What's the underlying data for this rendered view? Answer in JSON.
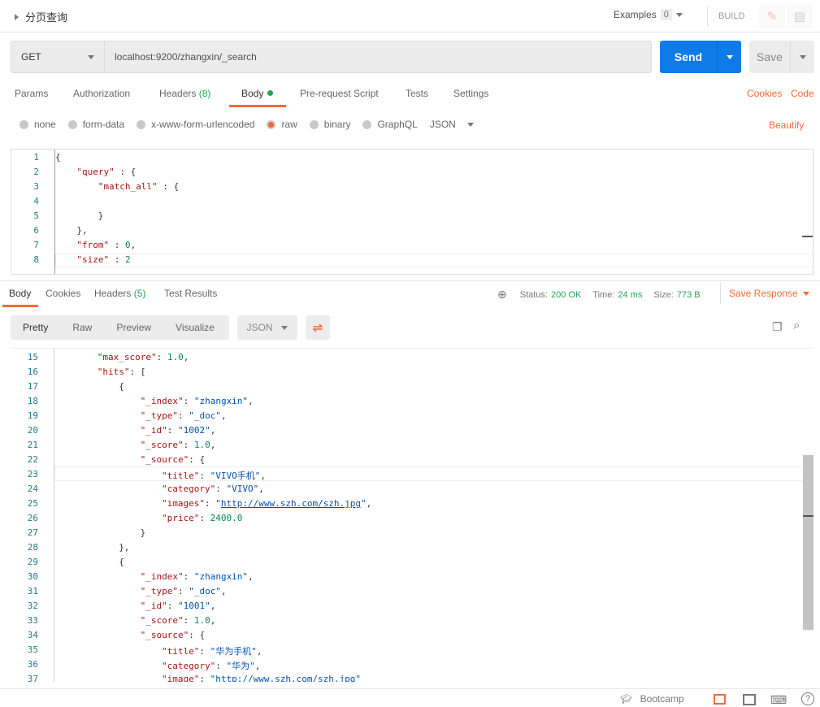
{
  "header": {
    "title": "分页查询",
    "examples_label": "Examples",
    "examples_count": "0",
    "build_label": "BUILD",
    "icons": [
      "pencil-icon",
      "comment-icon"
    ]
  },
  "request": {
    "method": "GET",
    "url": "localhost:9200/zhangxin/_search",
    "send_label": "Send",
    "save_label": "Save"
  },
  "request_tabs": [
    {
      "label": "Params"
    },
    {
      "label": "Authorization"
    },
    {
      "label": "Headers",
      "count": "(8)"
    },
    {
      "label": "Body",
      "active": true
    },
    {
      "label": "Pre-request Script"
    },
    {
      "label": "Tests"
    },
    {
      "label": "Settings"
    }
  ],
  "request_links": {
    "cookies": "Cookies",
    "code": "Code"
  },
  "body_types": [
    {
      "label": "none"
    },
    {
      "label": "form-data"
    },
    {
      "label": "x-www-form-urlencoded"
    },
    {
      "label": "raw",
      "selected": true
    },
    {
      "label": "binary"
    },
    {
      "label": "GraphQL"
    }
  ],
  "body_format": "JSON",
  "beautify_label": "Beautify",
  "request_body": [
    {
      "n": "1",
      "i": 0,
      "t": [
        [
          "p",
          "{"
        ]
      ]
    },
    {
      "n": "2",
      "i": 1,
      "t": [
        [
          "k",
          "\"query\""
        ],
        [
          "p",
          " : {"
        ]
      ]
    },
    {
      "n": "3",
      "i": 2,
      "t": [
        [
          "k",
          "\"match_all\""
        ],
        [
          "p",
          " : {"
        ]
      ]
    },
    {
      "n": "4",
      "i": 0,
      "t": []
    },
    {
      "n": "5",
      "i": 2,
      "t": [
        [
          "p",
          "}"
        ]
      ]
    },
    {
      "n": "6",
      "i": 1,
      "t": [
        [
          "p",
          "},"
        ]
      ]
    },
    {
      "n": "7",
      "i": 1,
      "t": [
        [
          "k",
          "\"from\""
        ],
        [
          "p",
          " : "
        ],
        [
          "n",
          "0"
        ],
        [
          "p",
          ","
        ]
      ]
    },
    {
      "n": "8",
      "i": 1,
      "t": [
        [
          "k",
          "\"size\""
        ],
        [
          "p",
          " : "
        ],
        [
          "n",
          "2"
        ]
      ]
    }
  ],
  "response_tabs": [
    {
      "label": "Body",
      "active": true
    },
    {
      "label": "Cookies"
    },
    {
      "label": "Headers",
      "count": "(5)"
    },
    {
      "label": "Test Results"
    }
  ],
  "response_meta": {
    "status_label": "Status:",
    "status": "200 OK",
    "time_label": "Time:",
    "time": "24 ms",
    "size_label": "Size:",
    "size": "773 B",
    "save_response": "Save Response"
  },
  "view_modes": [
    {
      "label": "Pretty",
      "active": true
    },
    {
      "label": "Raw"
    },
    {
      "label": "Preview"
    },
    {
      "label": "Visualize"
    }
  ],
  "response_format": "JSON",
  "response_body": [
    {
      "n": "15",
      "i": 2,
      "t": [
        [
          "k",
          "\"max_score\""
        ],
        [
          "p",
          ": "
        ],
        [
          "n",
          "1.0"
        ],
        [
          "p",
          ","
        ]
      ]
    },
    {
      "n": "16",
      "i": 2,
      "t": [
        [
          "k",
          "\"hits\""
        ],
        [
          "p",
          ": ["
        ]
      ]
    },
    {
      "n": "17",
      "i": 3,
      "t": [
        [
          "p",
          "{"
        ]
      ]
    },
    {
      "n": "18",
      "i": 4,
      "t": [
        [
          "k",
          "\"_index\""
        ],
        [
          "p",
          ": "
        ],
        [
          "s",
          "\"zhangxin\""
        ],
        [
          "p",
          ","
        ]
      ]
    },
    {
      "n": "19",
      "i": 4,
      "t": [
        [
          "k",
          "\"_type\""
        ],
        [
          "p",
          ": "
        ],
        [
          "s",
          "\"_doc\""
        ],
        [
          "p",
          ","
        ]
      ]
    },
    {
      "n": "20",
      "i": 4,
      "t": [
        [
          "k",
          "\"_id\""
        ],
        [
          "p",
          ": "
        ],
        [
          "s",
          "\"1002\""
        ],
        [
          "p",
          ","
        ]
      ]
    },
    {
      "n": "21",
      "i": 4,
      "t": [
        [
          "k",
          "\"_score\""
        ],
        [
          "p",
          ": "
        ],
        [
          "n",
          "1.0"
        ],
        [
          "p",
          ","
        ]
      ]
    },
    {
      "n": "22",
      "i": 4,
      "t": [
        [
          "k",
          "\"_source\""
        ],
        [
          "p",
          ": {"
        ]
      ]
    },
    {
      "n": "23",
      "i": 5,
      "t": [
        [
          "k",
          "\"title\""
        ],
        [
          "p",
          ": "
        ],
        [
          "s",
          "\"VIVO手机\""
        ],
        [
          "p",
          ","
        ]
      ]
    },
    {
      "n": "24",
      "i": 5,
      "t": [
        [
          "k",
          "\"category\""
        ],
        [
          "p",
          ": "
        ],
        [
          "s",
          "\"VIVO\""
        ],
        [
          "p",
          ","
        ]
      ]
    },
    {
      "n": "25",
      "i": 5,
      "t": [
        [
          "k",
          "\"images\""
        ],
        [
          "p",
          ": "
        ],
        [
          "s",
          "\""
        ],
        [
          "u",
          "http://www.szh.com/szh.jpg"
        ],
        [
          "s",
          "\""
        ],
        [
          "p",
          ","
        ]
      ]
    },
    {
      "n": "26",
      "i": 5,
      "t": [
        [
          "k",
          "\"price\""
        ],
        [
          "p",
          ": "
        ],
        [
          "n",
          "2400.0"
        ]
      ]
    },
    {
      "n": "27",
      "i": 4,
      "t": [
        [
          "p",
          "}"
        ]
      ]
    },
    {
      "n": "28",
      "i": 3,
      "t": [
        [
          "p",
          "},"
        ]
      ]
    },
    {
      "n": "29",
      "i": 3,
      "t": [
        [
          "p",
          "{"
        ]
      ]
    },
    {
      "n": "30",
      "i": 4,
      "t": [
        [
          "k",
          "\"_index\""
        ],
        [
          "p",
          ": "
        ],
        [
          "s",
          "\"zhangxin\""
        ],
        [
          "p",
          ","
        ]
      ]
    },
    {
      "n": "31",
      "i": 4,
      "t": [
        [
          "k",
          "\"_type\""
        ],
        [
          "p",
          ": "
        ],
        [
          "s",
          "\"_doc\""
        ],
        [
          "p",
          ","
        ]
      ]
    },
    {
      "n": "32",
      "i": 4,
      "t": [
        [
          "k",
          "\"_id\""
        ],
        [
          "p",
          ": "
        ],
        [
          "s",
          "\"1001\""
        ],
        [
          "p",
          ","
        ]
      ]
    },
    {
      "n": "33",
      "i": 4,
      "t": [
        [
          "k",
          "\"_score\""
        ],
        [
          "p",
          ": "
        ],
        [
          "n",
          "1.0"
        ],
        [
          "p",
          ","
        ]
      ]
    },
    {
      "n": "34",
      "i": 4,
      "t": [
        [
          "k",
          "\"_source\""
        ],
        [
          "p",
          ": {"
        ]
      ]
    },
    {
      "n": "35",
      "i": 5,
      "t": [
        [
          "k",
          "\"title\""
        ],
        [
          "p",
          ": "
        ],
        [
          "s",
          "\"华为手机\""
        ],
        [
          "p",
          ","
        ]
      ]
    },
    {
      "n": "36",
      "i": 5,
      "t": [
        [
          "k",
          "\"category\""
        ],
        [
          "p",
          ": "
        ],
        [
          "s",
          "\"华为\""
        ],
        [
          "p",
          ","
        ]
      ]
    },
    {
      "n": "37",
      "i": 5,
      "t": [
        [
          "k",
          "\"image\""
        ],
        [
          "p",
          ": "
        ],
        [
          "s",
          "\"http://www.szh.com/szh.jpg\""
        ]
      ]
    }
  ],
  "footer": {
    "bootcamp": "Bootcamp",
    "icons": [
      "two-pane-icon",
      "browse-icon",
      "keyboard-icon",
      "help-icon"
    ]
  },
  "colors": {
    "accent": "#f26b3a",
    "send": "#0f7be9",
    "success": "#26a54f"
  }
}
